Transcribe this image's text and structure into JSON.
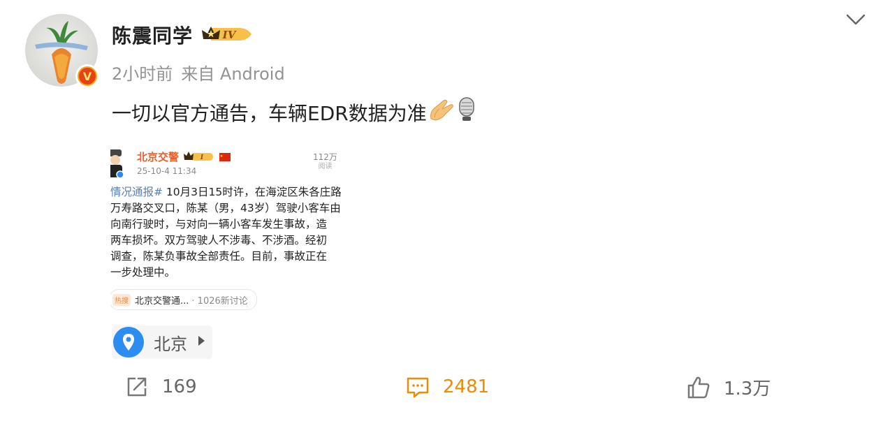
{
  "post": {
    "username": "陈震同学",
    "level_badge": "IV",
    "time": "2小时前",
    "source": "来自 Android",
    "text": "一切以官方通告，车辆EDR数据为准",
    "emojis": [
      "hands-pressed-emoji",
      "microphone-emoji"
    ]
  },
  "embedded_image": {
    "account_name": "北京交警",
    "account_badge": "I",
    "timestamp": "25-10-4 11:34",
    "reads": "112万",
    "reads_label": "阅读",
    "body_lines": [
      {
        "hash": "情况通报#",
        "text": " 10月3日15时许，在海淀区朱各庄路"
      },
      {
        "hash": "",
        "text": "万寿路交叉口，陈某（男，43岁）驾驶小客车由"
      },
      {
        "hash": "",
        "text": "向南行驶时，与对向一辆小客车发生事故，造"
      },
      {
        "hash": "",
        "text": "两车损坏。双方驾驶人不涉毒、不涉酒。经初"
      },
      {
        "hash": "",
        "text": "调查，陈某负事故全部责任。目前，事故正在"
      },
      {
        "hash": "",
        "text": "一步处理中。"
      }
    ],
    "topic_tag": "热搜",
    "topic_name": "北京交警通...",
    "topic_count": "· 1026新讨论"
  },
  "location": {
    "label": "北京"
  },
  "actions": {
    "repost_count": "169",
    "comment_count": "2481",
    "like_count": "1.3万"
  },
  "colors": {
    "accent_orange": "#f08a00",
    "text_gray": "#939393",
    "location_blue": "#2d8cf0",
    "verified_orange": "#f5a623"
  }
}
